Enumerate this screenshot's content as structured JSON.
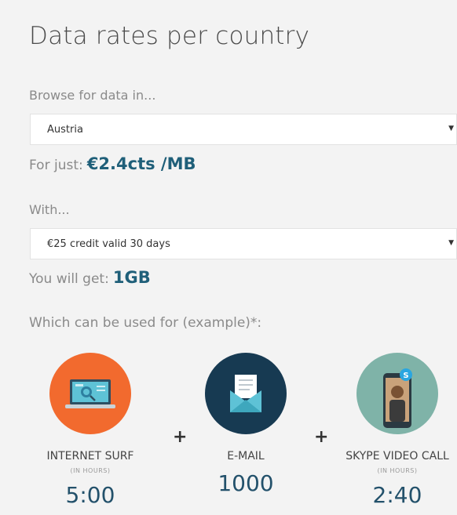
{
  "header": {
    "title": "Data rates per country"
  },
  "browse": {
    "label": "Browse for data in...",
    "selected": "Austria",
    "arrow": "▼"
  },
  "rate": {
    "prefix": "For just:",
    "value": "€2.4cts /MB"
  },
  "with": {
    "label": "With...",
    "selected": "€25 credit valid 30 days",
    "arrow": "▼"
  },
  "get": {
    "prefix": "You will get:",
    "value": "1GB"
  },
  "example_label": "Which can be used for (example)*:",
  "plus_sign": "+",
  "usages": [
    {
      "name": "INTERNET SURF",
      "sub": "(IN HOURS)",
      "value": "5:00",
      "icon": "laptop-globe-icon",
      "color": "#f26a2e"
    },
    {
      "name": "E-MAIL",
      "sub": "",
      "value": "1000",
      "icon": "envelope-icon",
      "color": "#173a52"
    },
    {
      "name": "SKYPE VIDEO CALL",
      "sub": "(IN HOURS)",
      "value": "2:40",
      "icon": "skype-phone-icon",
      "color": "#7fb3a8"
    }
  ]
}
